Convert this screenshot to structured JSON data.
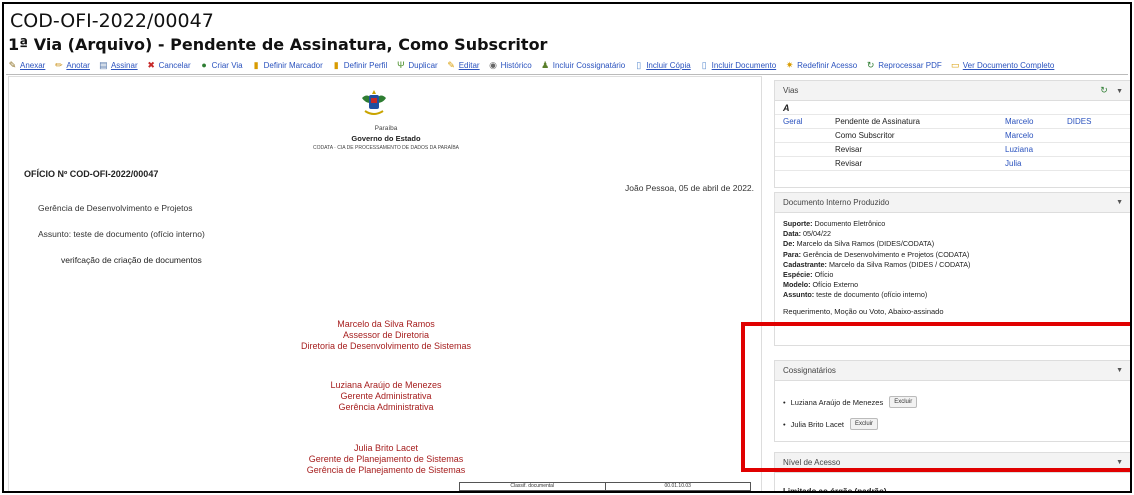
{
  "header": {
    "code": "COD-OFI-2022/00047",
    "subtitle": "1ª Via (Arquivo) - Pendente de Assinatura, Como Subscritor"
  },
  "toolbar": {
    "items": [
      {
        "label": "Anexar",
        "icon": "paperclip-icon",
        "glyph": "✎",
        "color": "#8a6d1f"
      },
      {
        "label": "Anotar",
        "icon": "note-icon",
        "glyph": "✏",
        "color": "#c98d10"
      },
      {
        "label": "Assinar",
        "icon": "sign-icon",
        "glyph": "▤",
        "color": "#5577aa"
      },
      {
        "label": "Cancelar",
        "icon": "cancel-icon",
        "glyph": "✖",
        "color": "#c62828"
      },
      {
        "label": "Criar Via",
        "icon": "new-via-icon",
        "glyph": "●",
        "color": "#2e7d32"
      },
      {
        "label": "Definir Marcador",
        "icon": "marker-icon",
        "glyph": "▮",
        "color": "#d89b00"
      },
      {
        "label": "Definir Perfil",
        "icon": "profile-icon",
        "glyph": "▮",
        "color": "#d89b00"
      },
      {
        "label": "Duplicar",
        "icon": "duplicate-icon",
        "glyph": "Ψ",
        "color": "#4a8f2a"
      },
      {
        "label": "Editar",
        "icon": "edit-icon",
        "glyph": "✎",
        "color": "#d89b00"
      },
      {
        "label": "Histórico",
        "icon": "history-icon",
        "glyph": "◉",
        "color": "#666"
      },
      {
        "label": "Incluir Cossignatário",
        "icon": "add-cosigner-icon",
        "glyph": "♟",
        "color": "#5a7f2a"
      },
      {
        "label": "Incluir Cópia",
        "icon": "copy-icon",
        "glyph": "▯",
        "color": "#5b8ccf"
      },
      {
        "label": "Incluir Documento",
        "icon": "add-document-icon",
        "glyph": "▯",
        "color": "#5b8ccf"
      },
      {
        "label": "Redefinir Acesso",
        "icon": "access-icon",
        "glyph": "✷",
        "color": "#d89b00"
      },
      {
        "label": "Reprocessar PDF",
        "icon": "reprocess-icon",
        "glyph": "↻",
        "color": "#2e7d32"
      },
      {
        "label": "Ver Documento Completo",
        "icon": "view-document-icon",
        "glyph": "▭",
        "color": "#d89b00"
      }
    ]
  },
  "document": {
    "state": "Paraíba",
    "government": "Governo do Estado",
    "agency": "CODATA · CIA DE PROCESSAMENTO DE DADOS DA PARAÍBA",
    "number": "OFÍCIO Nº COD-OFI-2022/00047",
    "date_line": "João Pessoa, 05 de abril de 2022.",
    "recipient": "Gerência de Desenvolvimento e Projetos",
    "subject": "Assunto: teste de documento (ofício interno)",
    "body": "verifcação de criação de documentos",
    "signatures": [
      {
        "name": "Marcelo da Silva Ramos",
        "role": "Assessor de Diretoria",
        "unit": "Diretoria de Desenvolvimento de Sistemas"
      },
      {
        "name": "Luziana Araújo de Menezes",
        "role": "Gerente Administrativa",
        "unit": "Gerência Administrativa"
      },
      {
        "name": "Julia Brito Lacet",
        "role": "Gerente de Planejamento de Sistemas",
        "unit": "Gerência de Planejamento de Sistemas"
      }
    ],
    "classif_label": "Classif. documental",
    "classif_value": "00.01.10.03"
  },
  "vias": {
    "title": "Vias",
    "letter": "A",
    "rows": [
      {
        "c1": "Geral",
        "c2": "Pendente de Assinatura",
        "c3": "Marcelo",
        "c4": "DIDES"
      },
      {
        "c1": "",
        "c2": "Como Subscritor",
        "c3": "Marcelo",
        "c4": ""
      },
      {
        "c1": "",
        "c2": "Revisar",
        "c3": "Luziana",
        "c4": ""
      },
      {
        "c1": "",
        "c2": "Revisar",
        "c3": "Julia",
        "c4": ""
      }
    ]
  },
  "doc_info": {
    "title": "Documento Interno Produzido",
    "suporte_label": "Suporte:",
    "suporte": "Documento Eletrônico",
    "data_label": "Data:",
    "data": "05/04/22",
    "de_label": "De:",
    "de": "Marcelo da Silva Ramos (DIDES/CODATA)",
    "para_label": "Para:",
    "para": "Gerência de Desenvolvimento e Projetos (CODATA)",
    "cad_label": "Cadastrante:",
    "cad": "Marcelo da Silva Ramos (DIDES / CODATA)",
    "especie_label": "Espécie:",
    "especie": "Ofício",
    "modelo_label": "Modelo:",
    "modelo": "Ofício Externo",
    "assunto_label": "Assunto:",
    "assunto": "teste de documento (ofício interno)",
    "extra": "Requerimento, Moção ou Voto, Abaixo-assinado"
  },
  "cossignatarios": {
    "title": "Cossignatários",
    "excluir_label": "Excluir",
    "items": [
      "Luziana Araújo de Menezes",
      "Julia Brito Lacet"
    ]
  },
  "nivel": {
    "title": "Nível de Acesso",
    "value": "Limitado ao órgão (padrão)"
  },
  "colors": {
    "link": "#2a52be",
    "signature": "#a61e1e",
    "highlight": "#e00000"
  }
}
